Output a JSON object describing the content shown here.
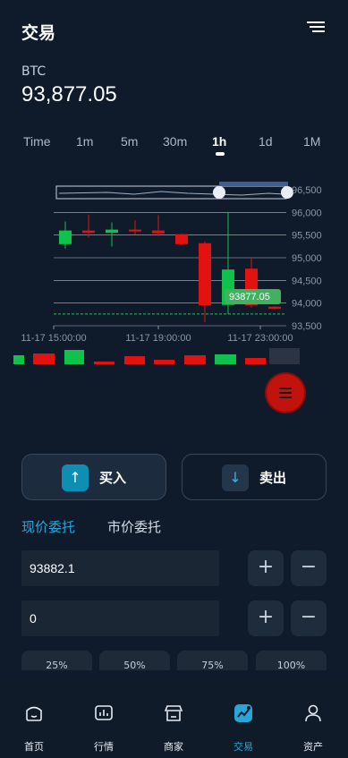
{
  "header": {
    "title": "交易"
  },
  "ticker": {
    "symbol": "BTC",
    "price": "93,877.05"
  },
  "intervals": [
    "Time",
    "1m",
    "5m",
    "30m",
    "1h",
    "1d",
    "1M"
  ],
  "active_interval": "1h",
  "chart_data": {
    "type": "candlestick",
    "y_ticks": [
      "96,500",
      "96,000",
      "95,500",
      "95,000",
      "94,500",
      "94,000",
      "93,500"
    ],
    "x_ticks": [
      "11-17 15:00:00",
      "11-17 19:00:00",
      "11-17 23:00:00"
    ],
    "current_price_label": "93877.05",
    "ylim": [
      93500,
      96500
    ],
    "candles": [
      {
        "open": 95300,
        "close": 95600,
        "high": 95800,
        "low": 95200,
        "color": "up"
      },
      {
        "open": 95600,
        "close": 95550,
        "high": 95950,
        "low": 95450,
        "color": "down"
      },
      {
        "open": 95550,
        "close": 95620,
        "high": 95780,
        "low": 95250,
        "color": "up"
      },
      {
        "open": 95620,
        "close": 95580,
        "high": 95830,
        "low": 95500,
        "color": "down"
      },
      {
        "open": 95600,
        "close": 95540,
        "high": 95940,
        "low": 95480,
        "color": "down"
      },
      {
        "open": 95520,
        "close": 95300,
        "high": 95530,
        "low": 95280,
        "color": "down"
      },
      {
        "open": 95320,
        "close": 93950,
        "high": 95360,
        "low": 93580,
        "color": "down"
      },
      {
        "open": 93960,
        "close": 94740,
        "high": 96010,
        "low": 93760,
        "color": "up"
      },
      {
        "open": 94760,
        "close": 93950,
        "high": 95000,
        "low": 93900,
        "color": "down"
      },
      {
        "open": 93920,
        "close": 93877,
        "high": 93930,
        "low": 93860,
        "color": "down"
      }
    ],
    "colors": {
      "up": "#11c24a",
      "down": "#e1120f"
    }
  },
  "trade": {
    "buy_label": "买入",
    "sell_label": "卖出",
    "buy_icon": "arrow-up-icon",
    "sell_icon": "arrow-down-icon"
  },
  "order_tabs": {
    "limit": "现价委托",
    "market": "市价委托"
  },
  "form": {
    "price_value": "93882.1",
    "amount_value": "0",
    "plus": "+",
    "minus": "−"
  },
  "percents": [
    "25%",
    "50%",
    "75%",
    "100%"
  ],
  "nav": [
    {
      "label": "首页",
      "icon": "home-icon"
    },
    {
      "label": "行情",
      "icon": "market-icon"
    },
    {
      "label": "商家",
      "icon": "shop-icon"
    },
    {
      "label": "交易",
      "icon": "trade-icon",
      "active": true
    },
    {
      "label": "资产",
      "icon": "user-icon"
    }
  ]
}
